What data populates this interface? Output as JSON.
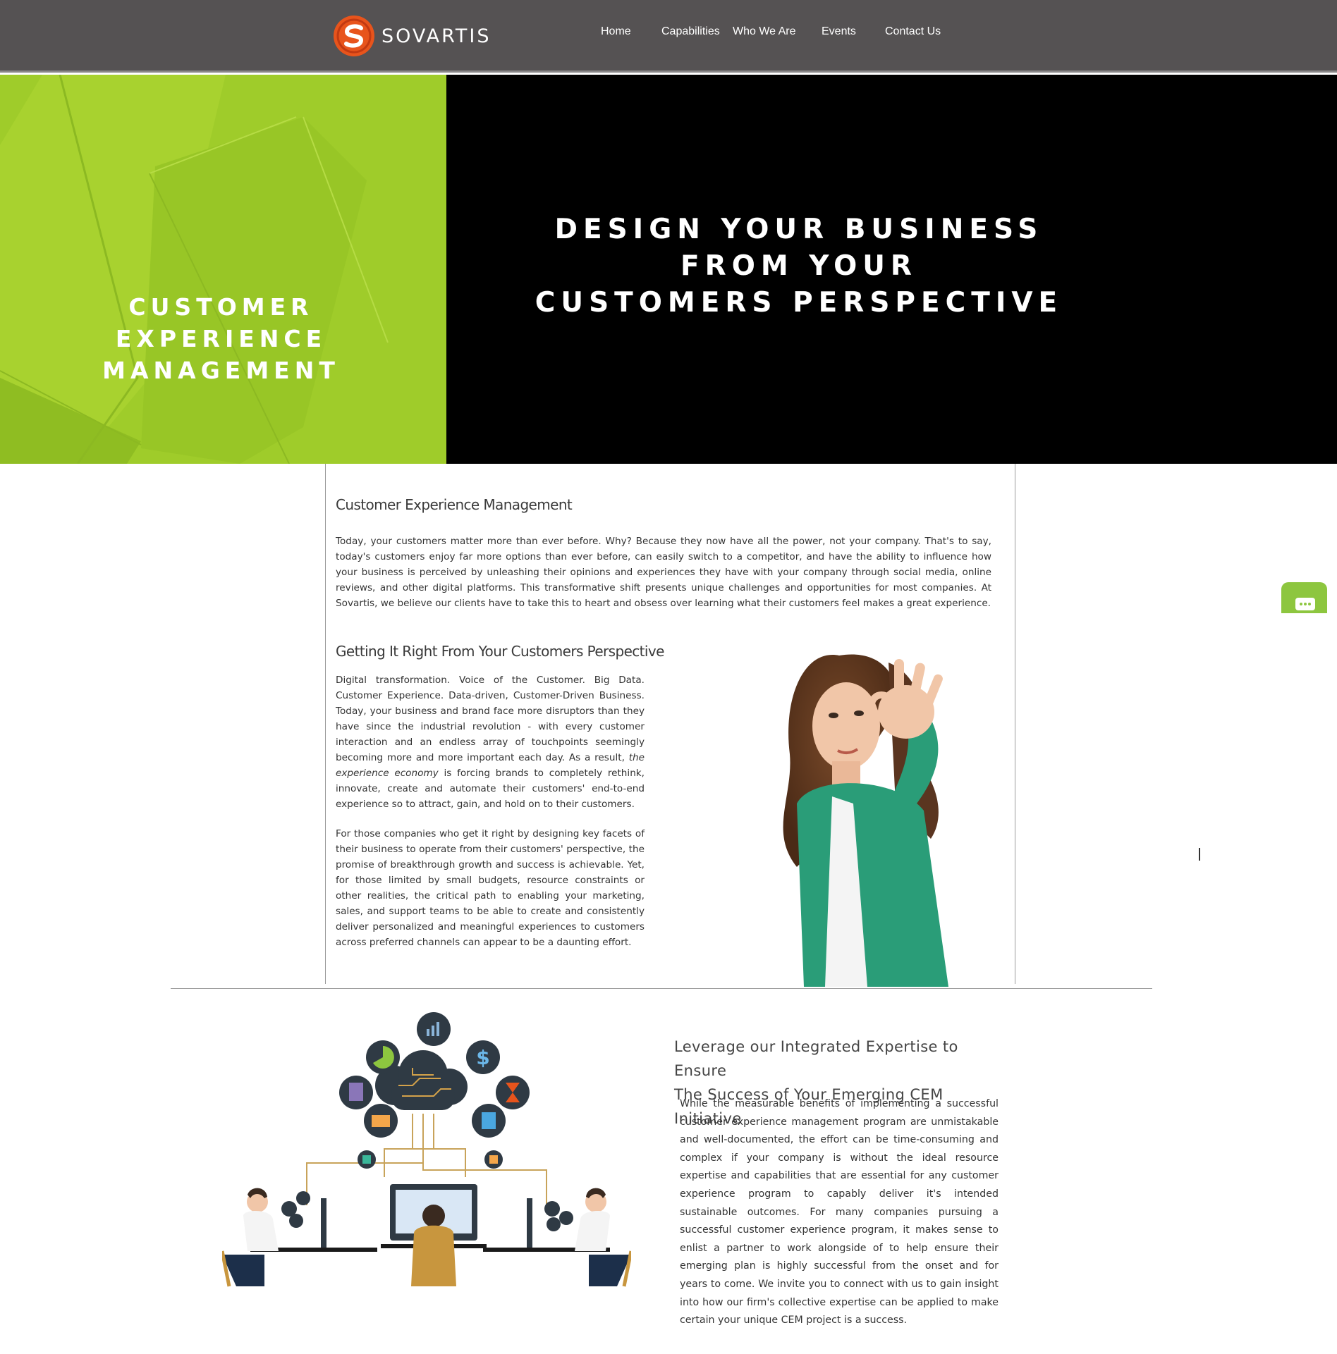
{
  "header": {
    "brand": "SOVARTIS",
    "nav": [
      {
        "label": "Home"
      },
      {
        "label": "Capabilities"
      },
      {
        "label": "Who We Are"
      },
      {
        "label": "Events"
      },
      {
        "label": "Contact Us"
      }
    ]
  },
  "hero": {
    "left_title_lines": [
      "CUSTOMER",
      "EXPERIENCE",
      "MANAGEMENT"
    ],
    "right_title_lines": [
      "DESIGN YOUR BUSINESS",
      "FROM YOUR",
      "CUSTOMERS PERSPECTIVE"
    ]
  },
  "section1": {
    "heading": "Customer Experience Management",
    "body": "Today, your customers matter more than ever before. Why? Because they now have all the power, not your company. That's to say, today's customers enjoy far more options than ever before, can easily switch to a competitor, and have the ability to influence how your business is perceived by unleashing their opinions and experiences they have with your company through social media, online reviews, and other digital platforms. This transformative shift presents unique challenges and opportunities for most companies. At Sovartis, we believe our clients have to take this to heart and obsess over learning what their customers feel makes a great experience."
  },
  "section2": {
    "heading": "Getting It Right From Your Customers Perspective",
    "para1_before": "Digital transformation. Voice of the Customer. Big Data. Customer Experience. Data-driven, Customer-Driven Business. Today, your business and brand face more disruptors than they have since the industrial revolution -  with every customer interaction and an endless array of touchpoints seemingly becoming more and more important each day. As a result, ",
    "para1_em": "the experience economy",
    "para1_after": " is forcing brands to completely rethink, innovate, create and automate their customers' end-to-end experience so to attract, gain, and hold on to their customers.",
    "para2": "For those companies who get it right by designing key facets of their business to operate from their customers' perspective, the promise of breakthrough growth and success is achievable. Yet, for those limited by small budgets, resource constraints or other realities, the critical path to enabling your marketing, sales, and support teams to be able to create and consistently deliver personalized and meaningful experiences to customers across preferred channels can appear to be a daunting effort."
  },
  "section3": {
    "heading_lines": [
      "Leverage our Integrated Expertise to Ensure",
      "The Success of Your Emerging CEM Initiative"
    ],
    "body": "While the measurable benefits of implementing a successful customer experience management program are unmistakable and well-documented, the effort can be time-consuming and complex if your company is without the ideal resource expertise and capabilities that are essential for any customer experience program to capably deliver it's intended sustainable outcomes. For many companies pursuing a successful customer experience program, it makes sense to enlist a partner to work alongside of to help ensure their emerging plan is highly successful from the onset and for years to come. We invite you to connect with us to gain insight into how our firm's collective expertise can be applied to make certain your unique CEM project is a success."
  },
  "colors": {
    "header_bg": "#555253",
    "hero_green": "#9fcc2a",
    "hero_black": "#000000",
    "chat_green": "#8dc63f",
    "logo_orange": "#e8541c"
  },
  "icons": [
    "sovartis-logo-icon",
    "chat-icon",
    "bar-chart-icon",
    "pie-chart-icon",
    "dollar-icon",
    "document-icon",
    "cloud-circuit-icon",
    "hourglass-icon",
    "mail-icon",
    "contacts-icon"
  ]
}
